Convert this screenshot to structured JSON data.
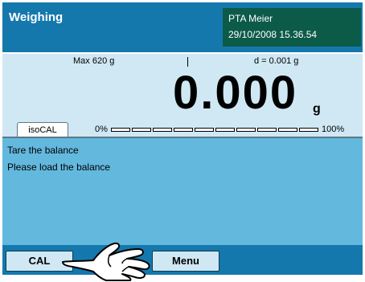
{
  "header": {
    "title": "Weighing",
    "user": "PTA Meier",
    "datetime": "29/10/2008 15.36.54"
  },
  "weighing": {
    "max": "Max 620 g",
    "readability": "d = 0.001 g",
    "value": "0.000",
    "unit": "g",
    "isocal_label": "isoCAL",
    "bar_min": "0%",
    "bar_max": "100%",
    "bar_fill": 0
  },
  "messages": [
    "Tare the balance",
    "Please load the balance"
  ],
  "softkeys": {
    "cal": "CAL",
    "menu": "Menu"
  },
  "colors": {
    "header": "#1578ad",
    "user_box": "#0c5a48",
    "weigh_bg": "#cfe8f4",
    "message_bg": "#63b8de"
  },
  "icons": {
    "pointer": "pointing-hand-icon"
  }
}
